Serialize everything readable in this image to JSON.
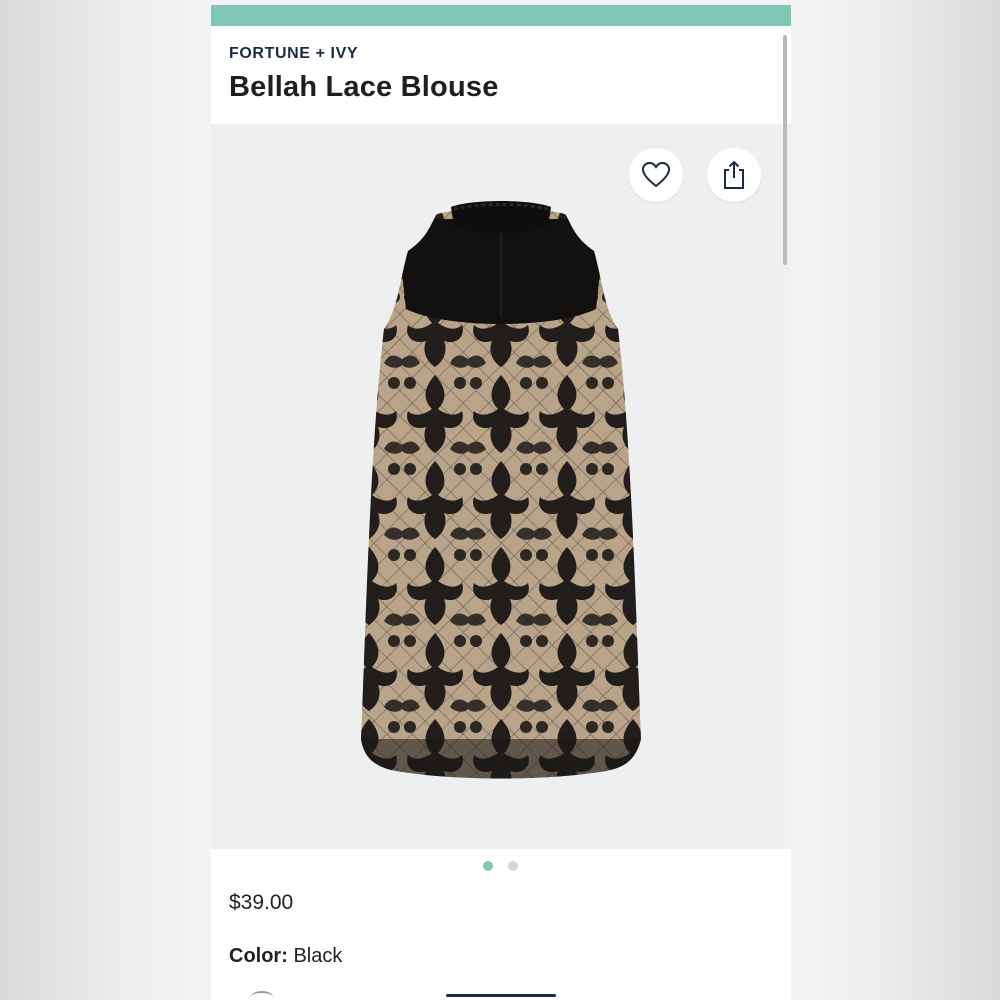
{
  "product": {
    "brand": "FORTUNE + IVY",
    "title": "Bellah Lace Blouse",
    "price": "$39.00",
    "color_label": "Color:",
    "color_value": "Black"
  },
  "actions": {
    "favorite_icon": "heart-icon",
    "share_icon": "share-icon"
  },
  "carousel": {
    "page_count": 2,
    "active_index": 0
  },
  "colors": {
    "accent": "#7fc6b5",
    "brand_text": "#1b2a48"
  }
}
